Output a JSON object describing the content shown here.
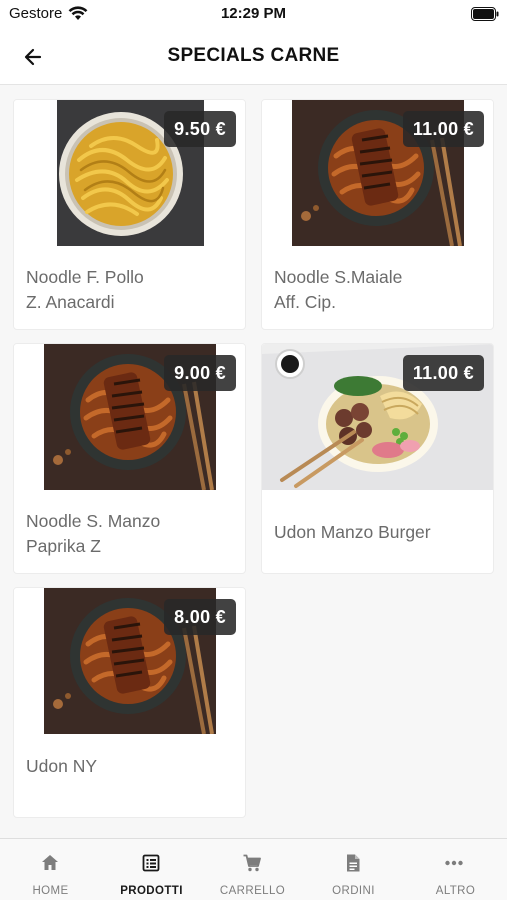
{
  "status_bar": {
    "carrier": "Gestore",
    "time": "12:29 PM"
  },
  "header": {
    "title": "SPECIALS CARNE",
    "back_icon": "arrow-left-icon"
  },
  "products": [
    {
      "name": "Noodle F. Pollo\nZ. Anacardi",
      "price": "9.50 €",
      "image": "yellow-noodles-bowl"
    },
    {
      "name": "Noodle S.Maiale\nAff. Cip.",
      "price": "11.00 €",
      "image": "dark-noodles-bowl"
    },
    {
      "name": "Noodle S. Manzo\nPaprika Z",
      "price": "9.00 €",
      "image": "dark-noodles-bowl"
    },
    {
      "name": "Udon Manzo Burger",
      "price": "11.00 €",
      "image": "udon-beef-bowl"
    },
    {
      "name": "Udon NY",
      "price": "8.00 €",
      "image": "dark-noodles-bowl"
    }
  ],
  "tabs": [
    {
      "label": "HOME",
      "icon": "home-icon",
      "active": false
    },
    {
      "label": "PRODOTTI",
      "icon": "list-icon",
      "active": true
    },
    {
      "label": "CARRELLO",
      "icon": "cart-icon",
      "active": false
    },
    {
      "label": "ORDINI",
      "icon": "document-icon",
      "active": false
    },
    {
      "label": "ALTRO",
      "icon": "more-icon",
      "active": false
    }
  ],
  "colors": {
    "price_badge": "#2b2b2b",
    "active_tab": "#1a1a1a",
    "inactive_tab": "#7d7d7d"
  }
}
